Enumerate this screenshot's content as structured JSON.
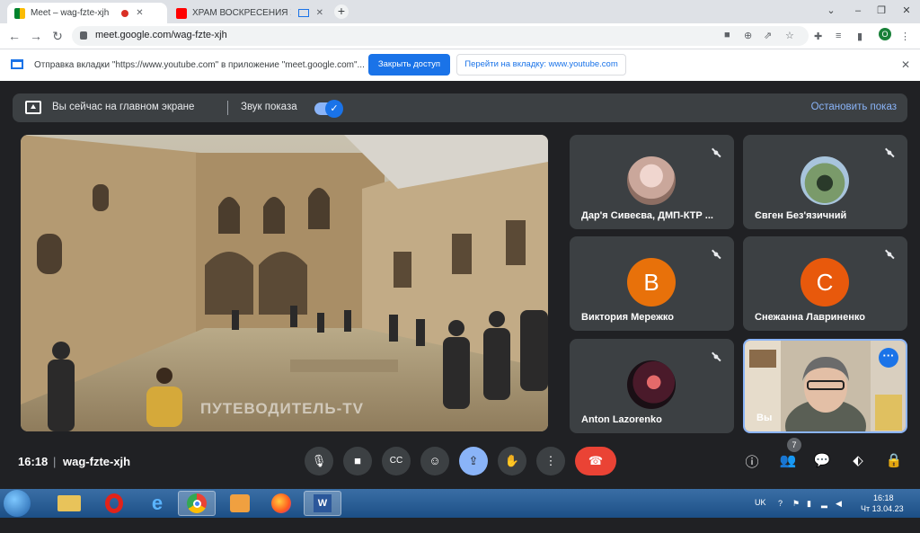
{
  "browser": {
    "tabs": [
      {
        "title": "Meet – wag-fzte-xjh",
        "active": true,
        "recording": true
      },
      {
        "title": "ХРАМ ВОСКРЕСЕНИЯ ХРИСТ",
        "active": false,
        "sharing": true
      }
    ],
    "new_tab": "+",
    "window_controls": {
      "minimize": "–",
      "maximize": "❐",
      "close": "✕"
    },
    "address": "meet.google.com/wag-fzte-xjh",
    "profile_initial": "O"
  },
  "infobar": {
    "message": "Отправка вкладки \"https://www.youtube.com\" в приложение \"meet.google.com\"...",
    "share_button": "Закрыть доступ",
    "switch_button": "Перейти на вкладку: www.youtube.com"
  },
  "banner": {
    "presenting_text": "Вы сейчас на главном экране",
    "sound_label": "Звук показа",
    "stop_label": "Остановить показ"
  },
  "main_video": {
    "watermark": "ПУТЕВОДИТЕЛЬ-TV"
  },
  "participants": [
    {
      "name": "Дар'я Сивеєва, ДМП-КТР ...",
      "type": "photo"
    },
    {
      "name": "Євген Без'язичний",
      "type": "photo"
    },
    {
      "name": "Виктория Мережко",
      "type": "letter",
      "letter": "B",
      "color": "#e8710a"
    },
    {
      "name": "Снежанна Лавриненко",
      "type": "letter",
      "letter": "C",
      "color": "#e8590c"
    },
    {
      "name": "Anton Lazorenko",
      "type": "photo"
    },
    {
      "name": "Вы",
      "type": "self"
    }
  ],
  "controls": {
    "time": "16:18",
    "separator": "|",
    "meeting_code": "wag-fzte-xjh",
    "participant_count": "7",
    "captions_label": "CC"
  },
  "taskbar": {
    "language": "UK",
    "clock_time": "16:18",
    "clock_date": "Чт 13.04.23"
  }
}
